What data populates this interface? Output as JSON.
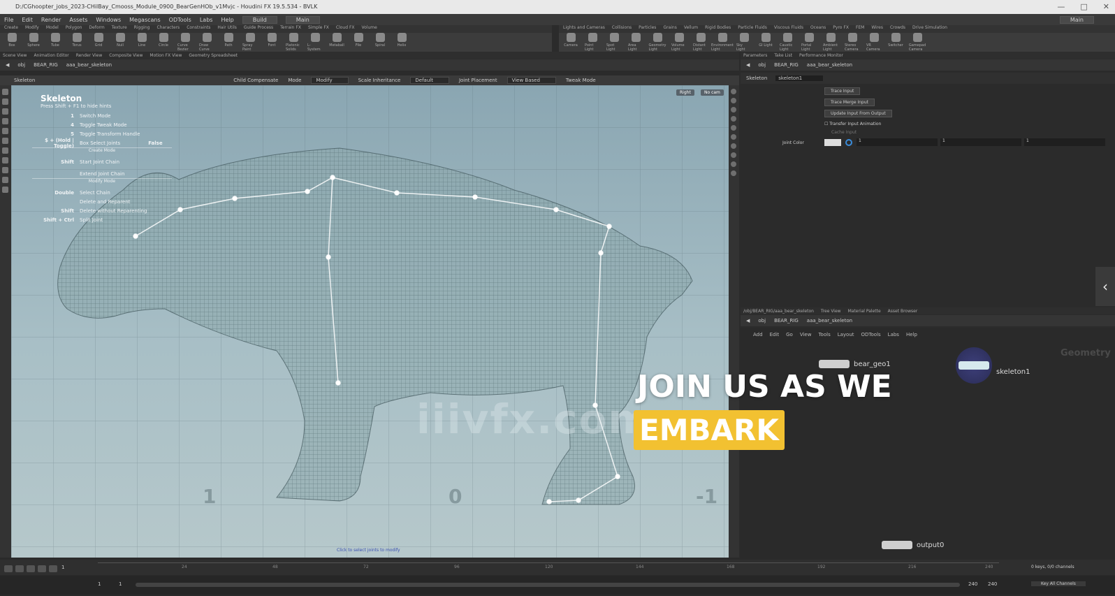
{
  "window": {
    "title": "D:/CGhoopter_jobs_2023-CHilBay_Cmooss_Module_0900_BearGenHOb_v1Mvjc - Houdini FX 19.5.534 - BVLK"
  },
  "menubar": {
    "items": [
      "File",
      "Edit",
      "Render",
      "Assets",
      "Windows",
      "Megascans",
      "ODTools",
      "Labs",
      "Help"
    ],
    "desktop_label": "Build",
    "workspace_label": "Main",
    "right_label": "Main"
  },
  "shelf": {
    "tabs_left": [
      "Create",
      "Modify",
      "Model",
      "Polygon",
      "Deform",
      "Texture",
      "Rigging",
      "Characters",
      "Constraints",
      "Hair Utils",
      "Guide Process",
      "Terrain FX",
      "Simple FX",
      "Cloud FX",
      "Volume"
    ],
    "tabs_right": [
      "Lights and Cameras",
      "Collisions",
      "Particles",
      "Grains",
      "Vellum",
      "Rigid Bodies",
      "Particle Fluids",
      "Viscous Fluids",
      "Oceans",
      "Pyro FX",
      "FEM",
      "Wires",
      "Crowds",
      "Drive Simulation"
    ],
    "tools_left": [
      "Box",
      "Sphere",
      "Tube",
      "Torus",
      "Grid",
      "Null",
      "Line",
      "Circle",
      "Curve Bezier",
      "Draw Curve",
      "Path",
      "Spray Paint",
      "Font",
      "Platonic Solids",
      "L-System",
      "Metaball",
      "File",
      "Spiral",
      "Helix"
    ],
    "tools_right": [
      "Camera",
      "Point Light",
      "Spot Light",
      "Area Light",
      "Geometry Light",
      "Volume Light",
      "Distant Light",
      "Environment Light",
      "Sky Light",
      "GI Light",
      "Caustic Light",
      "Portal Light",
      "Ambient Light",
      "Stereo Camera",
      "VR Camera",
      "Switcher",
      "Gamepad Camera"
    ]
  },
  "left_pane": {
    "tabs": [
      "Scene View",
      "Animation Editor",
      "Render View",
      "Composite View",
      "Motion FX View",
      "Geometry Spreadsheet"
    ],
    "path": {
      "obj": "obj",
      "rig": "BEAR_RIG",
      "node": "aaa_bear_skeleton"
    },
    "op": {
      "name": "Skeleton",
      "child_compensate": "Child Compensate",
      "mode_label": "Mode",
      "mode_value": "Modify",
      "scale_inheritance_label": "Scale Inheritance",
      "scale_inheritance_value": "Default",
      "joint_placement_label": "Joint Placement",
      "joint_placement_value": "View Based",
      "tweak_mode": "Tweak Mode"
    }
  },
  "hud": {
    "title": "Skeleton",
    "subtitle": "Press Shift + F1 to hide hints",
    "rows": [
      {
        "key": "1",
        "action": "Switch Mode"
      },
      {
        "key": "4",
        "action": "Toggle Tweak Mode"
      },
      {
        "key": "5",
        "action": "Toggle Transform Handle"
      },
      {
        "key": "$ + (Hold | Toggle)",
        "action": "Box Select Joints",
        "value": "False"
      }
    ],
    "section_create": "Create Mode",
    "create_rows": [
      {
        "key": "Shift",
        "action": "Start Joint Chain"
      },
      {
        "key": "",
        "action": "Extend Joint Chain"
      }
    ],
    "section_modify": "Modify Mode",
    "modify_rows": [
      {
        "key": "Double",
        "action": "Select Chain"
      },
      {
        "key": "",
        "action": "Delete and Reparent"
      },
      {
        "key": "Shift",
        "action": "Delete without Reparenting"
      },
      {
        "key": "Shift + Ctrl",
        "action": "Split Joint"
      }
    ],
    "view_right": "Right",
    "view_cam": "No cam",
    "footer_hint": "Click to select joints to modify",
    "grid_numbers": [
      "1",
      "0",
      "-1"
    ]
  },
  "watermark": "iiivfx.com",
  "right_top": {
    "tabs": [
      "Parameters",
      "Take List",
      "Performance Monitor"
    ],
    "path": {
      "obj": "obj",
      "rig": "BEAR_RIG",
      "node": "aaa_bear_skeleton"
    },
    "op_type": "Skeleton",
    "op_name": "skeleton1",
    "buttons": [
      "Trace Input",
      "Trace Merge Input",
      "Update Input From Output"
    ],
    "checkbox_label": "Transfer Input Animation",
    "extra_label": "Cache Input",
    "joint_color_label": "Joint Color",
    "joint_color_values": [
      "1",
      "1",
      "1"
    ]
  },
  "right_bottom": {
    "tabs": [
      "/obj/BEAR_RIG/aaa_bear_skeleton",
      "Tree View",
      "Material Palette",
      "Asset Browser"
    ],
    "path": {
      "obj": "obj",
      "rig": "BEAR_RIG",
      "node": "aaa_bear_skeleton"
    },
    "menu": [
      "Add",
      "Edit",
      "Go",
      "View",
      "Tools",
      "Layout",
      "ODTools",
      "Labs",
      "Help"
    ],
    "context_label": "Geometry",
    "nodes": [
      {
        "name": "bear_geo1"
      },
      {
        "name": "skeleton1"
      },
      {
        "name": "output0"
      }
    ]
  },
  "timeline": {
    "frame": "1",
    "start": "1",
    "end": "1",
    "range_end_a": "240",
    "range_end_b": "240",
    "keys_label": "0 keys, 0/0 channels",
    "key_all_channels": "Key All Channels",
    "tick_labels": [
      "24",
      "48",
      "72",
      "96",
      "120",
      "144",
      "168",
      "192",
      "216",
      "240"
    ]
  },
  "overlay": {
    "line1": "JOIN US AS WE",
    "line2": "EMBARK"
  },
  "colors": {
    "accent": "#f2c131",
    "viewport_top": "#8aa6b2",
    "viewport_bottom": "#b6c8cb"
  },
  "icons": {
    "node_icon_names": [
      "geo-node-icon",
      "skeleton-node-icon",
      "output-node-icon"
    ]
  }
}
